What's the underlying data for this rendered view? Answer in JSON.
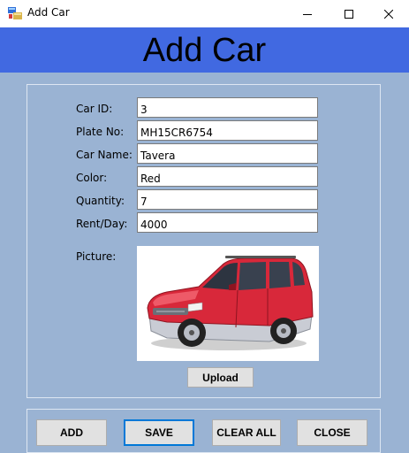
{
  "window": {
    "title": "Add Car",
    "controls": [
      "minimize-icon",
      "maximize-icon",
      "close-icon"
    ]
  },
  "header": {
    "title": "Add Car"
  },
  "form": {
    "fields": [
      {
        "label": "Car ID:",
        "value": "3"
      },
      {
        "label": "Plate No:",
        "value": "MH15CR6754"
      },
      {
        "label": "Car Name:",
        "value": "Tavera"
      },
      {
        "label": "Color:",
        "value": "Red"
      },
      {
        "label": "Quantity:",
        "value": "7"
      },
      {
        "label": "Rent/Day:",
        "value": "4000"
      }
    ],
    "picture_label": "Picture:",
    "picture_icon": "red-suv-car-image",
    "upload_label": "Upload"
  },
  "actions": {
    "add": "ADD",
    "save": "SAVE",
    "clear_all": "CLEAR ALL",
    "close": "CLOSE"
  },
  "colors": {
    "header_bg": "#4169e1",
    "form_bg": "#9ab3d3",
    "button_bg": "#e1e1e1",
    "focus_border": "#0078d7"
  }
}
